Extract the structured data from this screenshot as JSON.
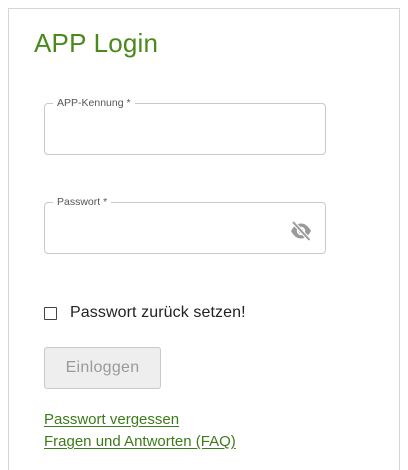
{
  "login": {
    "title": "APP Login",
    "app_id_label": "APP-Kennung *",
    "app_id_value": "",
    "password_label": "Passwort *",
    "password_value": "",
    "reset_password_checkbox_label": "Passwort zurück setzen!",
    "reset_password_checked": false,
    "login_button_label": "Einloggen",
    "login_button_disabled": true,
    "links": {
      "forgot_password": "Passwort vergessen",
      "faq": "Fragen und Antworten (FAQ)"
    },
    "icons": {
      "password_visibility": "eye-off-icon"
    },
    "colors": {
      "brand_green": "#4a8a1c",
      "link_green": "#3d7a1a",
      "disabled_text": "#9a9a9a"
    }
  }
}
